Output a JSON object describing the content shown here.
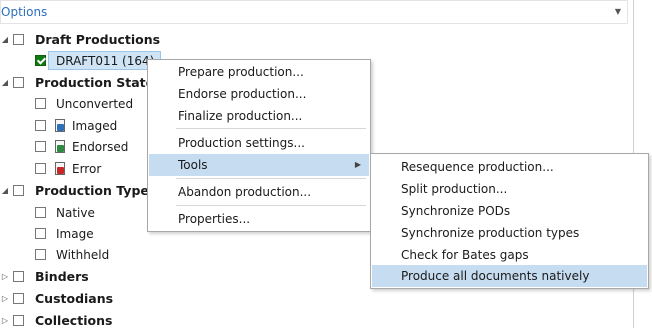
{
  "options": {
    "label": "Options"
  },
  "tree": {
    "draft_productions": "Draft Productions",
    "draft_item": "DRAFT011 (164)",
    "production_state": "Production State",
    "unconverted": "Unconverted",
    "imaged": "Imaged",
    "endorsed": "Endorsed",
    "error": "Error",
    "production_type": "Production Type",
    "native": "Native",
    "image": "Image",
    "withheld": "Withheld",
    "binders": "Binders",
    "custodians": "Custodians",
    "collections": "Collections"
  },
  "context_menu": {
    "items": [
      "Prepare production...",
      "Endorse production...",
      "Finalize production...",
      "Production settings...",
      "Tools",
      "Abandon production...",
      "Properties..."
    ]
  },
  "tools_submenu": {
    "items": [
      "Resequence production...",
      "Split production...",
      "Synchronize PODs",
      "Synchronize production types",
      "Check for Bates gaps",
      "Produce all documents natively"
    ]
  },
  "colors": {
    "options_label": "#2c6fbf",
    "selection": "#cfe4f5",
    "menu_highlight": "#c6dcf0",
    "check_green": "#0f7a0f"
  }
}
